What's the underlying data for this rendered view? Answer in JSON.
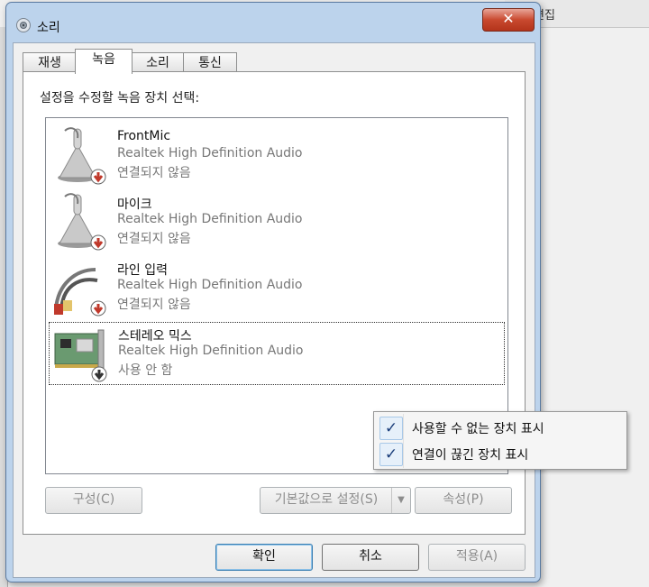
{
  "background": {
    "text_1": "편집"
  },
  "window": {
    "title": "소리",
    "close_glyph": "✕"
  },
  "tabs": [
    {
      "label": "재생"
    },
    {
      "label": "녹음"
    },
    {
      "label": "소리"
    },
    {
      "label": "통신"
    }
  ],
  "panel": {
    "label": "설정을 수정할 녹음 장치 선택:",
    "devices": [
      {
        "name": "FrontMic",
        "driver": "Realtek High Definition Audio",
        "status": "연결되지 않음",
        "icon": "microphone-icon",
        "badge": "red-down-arrow"
      },
      {
        "name": "마이크",
        "driver": "Realtek High Definition Audio",
        "status": "연결되지 않음",
        "icon": "microphone-icon",
        "badge": "red-down-arrow"
      },
      {
        "name": "라인 입력",
        "driver": "Realtek High Definition Audio",
        "status": "연결되지 않음",
        "icon": "rca-cable-icon",
        "badge": "red-down-arrow"
      },
      {
        "name": "스테레오 믹스",
        "driver": "Realtek High Definition Audio",
        "status": "사용 안 함",
        "icon": "sound-card-icon",
        "badge": "gray-down-arrow"
      }
    ],
    "configure_label": "구성(C)",
    "set_default_label": "기본값으로 설정(S)",
    "properties_label": "속성(P)"
  },
  "footer": {
    "ok_label": "확인",
    "cancel_label": "취소",
    "apply_label": "적용(A)"
  },
  "context_menu": {
    "items": [
      {
        "label": "사용할 수 없는 장치 표시",
        "checked": true
      },
      {
        "label": "연결이 끊긴 장치 표시",
        "checked": true
      }
    ],
    "check_glyph": "✓"
  },
  "colors": {
    "window_frame": "#bcd3ec",
    "close_button": "#c9492f",
    "default_button_border": "#3c7fb1",
    "disabled_badge": "#c0392b"
  }
}
